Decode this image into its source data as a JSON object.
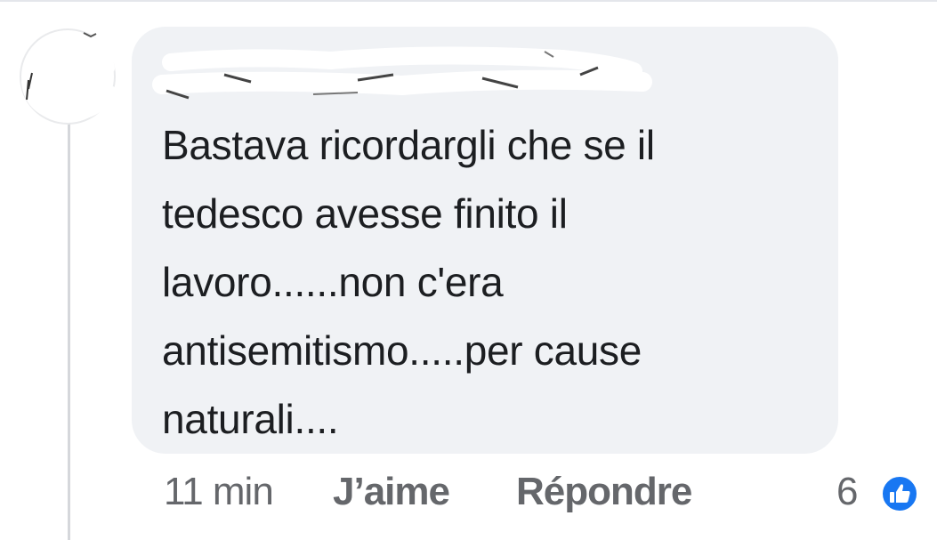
{
  "comment": {
    "author_name": "",
    "text": "Bastava ricordargli che se il\ntedesco avesse finito il\nlavoro......non c'era\nantisemitismo.....per cause\nnaturali....",
    "bubble_color": "#f0f2f5",
    "text_color": "#1c1e21"
  },
  "actions": {
    "timestamp": "11 min",
    "like_label": "J’aime",
    "reply_label": "Répondre",
    "reaction_count": "6",
    "reaction_icon": "thumbs-up-icon",
    "reaction_color": "#1877f2",
    "action_color": "#65676b"
  }
}
